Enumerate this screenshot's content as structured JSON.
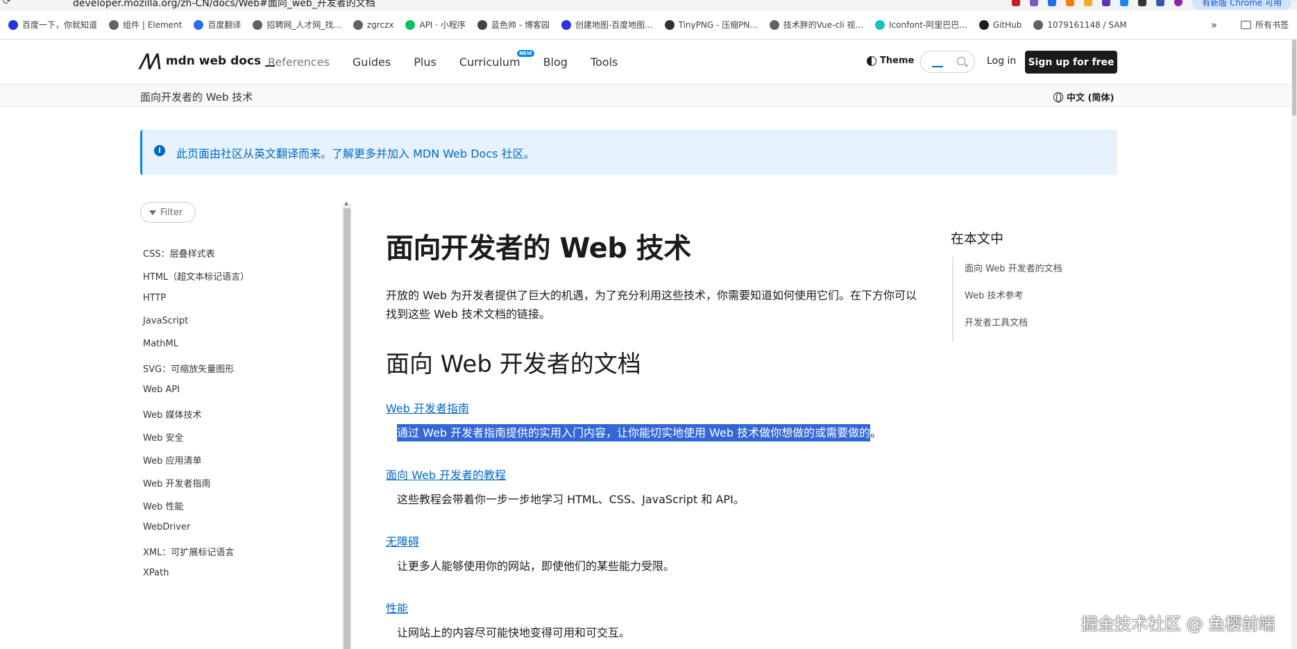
{
  "browser": {
    "url": "developer.mozilla.org/zh-CN/docs/Web#面向_web_开发者的文档",
    "update_label": "有新版 Chrome 可用",
    "extension_badge": "14",
    "bookmarks": [
      {
        "label": "百度一下，你就知道",
        "icon": "baidu-paw-icon",
        "color": "#2932e1"
      },
      {
        "label": "组件 | Element",
        "icon": "globe-icon",
        "color": "#5f6368"
      },
      {
        "label": "百度翻译",
        "icon": "translate-icon",
        "color": "#2b6de8"
      },
      {
        "label": "招聘网_人才网_找...",
        "icon": "globe-icon",
        "color": "#5f6368"
      },
      {
        "label": "zgrczx",
        "icon": "globe-icon",
        "color": "#5f6368"
      },
      {
        "label": "API · 小程序",
        "icon": "wechat-icon",
        "color": "#07c160"
      },
      {
        "label": "蓝色帅 - 博客园",
        "icon": "cnblogs-icon",
        "color": "#444444"
      },
      {
        "label": "创建地图-百度地图...",
        "icon": "baidu-paw-icon",
        "color": "#2932e1"
      },
      {
        "label": "TinyPNG - 压缩PN...",
        "icon": "panda-icon",
        "color": "#333333"
      },
      {
        "label": "技术胖的Vue-cli 视...",
        "icon": "globe-icon",
        "color": "#5f6368"
      },
      {
        "label": "Iconfont-阿里巴巴...",
        "icon": "iconfont-icon",
        "color": "#14c2c4"
      },
      {
        "label": "GitHub",
        "icon": "github-icon",
        "color": "#1b1f23"
      },
      {
        "label": "1079161148 / SAM",
        "icon": "globe-icon",
        "color": "#5f6368"
      }
    ],
    "more_glyph": "»",
    "all_bookmarks": "所有书签"
  },
  "header": {
    "logo_text": "mdn web docs",
    "nav": [
      {
        "label": "References",
        "dim": true
      },
      {
        "label": "Guides",
        "dim": false
      },
      {
        "label": "Plus",
        "dim": false
      },
      {
        "label": "Curriculum",
        "dim": false,
        "badge": "NEW"
      },
      {
        "label": "Blog",
        "dim": false
      },
      {
        "label": "Tools",
        "dim": false
      }
    ],
    "theme_label": "Theme",
    "login_label": "Log in",
    "signup_label": "Sign up for free"
  },
  "breadcrumb": {
    "current": "面向开发者的 Web 技术",
    "language": "中文 (简体)"
  },
  "notice": {
    "text": "此页面由社区从英文翻译而来。了解更多并加入 MDN Web Docs 社区。"
  },
  "sidebar": {
    "filter_label": "Filter",
    "items": [
      "CSS：层叠样式表",
      "HTML（超文本标记语言）",
      "HTTP",
      "JavaScript",
      "MathML",
      "SVG：可缩放矢量图形",
      "Web API",
      "Web 媒体技术",
      "Web 安全",
      "Web 应用清单",
      "Web 开发者指南",
      "Web 性能",
      "WebDriver",
      "XML：可扩展标记语言",
      "XPath"
    ]
  },
  "main": {
    "title": "面向开发者的 Web 技术",
    "intro": "开放的 Web 为开发者提供了巨大的机遇，为了充分利用这些技术，你需要知道如何使用它们。在下方你可以找到这些 Web 技术文档的链接。",
    "section_title": "面向 Web 开发者的文档",
    "entries": [
      {
        "term": "Web 开发者指南",
        "desc": "通过 Web 开发者指南提供的实用入门内容，让你能切实地使用 Web 技术做你想做的或需要做的",
        "desc_tail": "。",
        "selected": true
      },
      {
        "term": "面向 Web 开发者的教程",
        "desc": "这些教程会带着你一步一步地学习 HTML、CSS、JavaScript 和 API。",
        "desc_tail": "",
        "selected": false
      },
      {
        "term": "无障碍",
        "desc": "让更多人能够使用你的网站，即使他们的某些能力受限。",
        "desc_tail": "",
        "selected": false
      },
      {
        "term": "性能",
        "desc": "让网站上的内容尽可能快地变得可用和可交互。",
        "desc_tail": "",
        "selected": false
      }
    ]
  },
  "toc": {
    "title": "在本文中",
    "items": [
      "面向 Web 开发者的文档",
      "Web 技术参考",
      "开发者工具文档"
    ]
  },
  "watermark": "掘金技术社区 @ 鱼樱前端",
  "colors": {
    "link": "#0069c2",
    "selection": "#3367d6",
    "notice_bg": "#e6f2fd",
    "signup_bg": "#1b1b1b"
  }
}
